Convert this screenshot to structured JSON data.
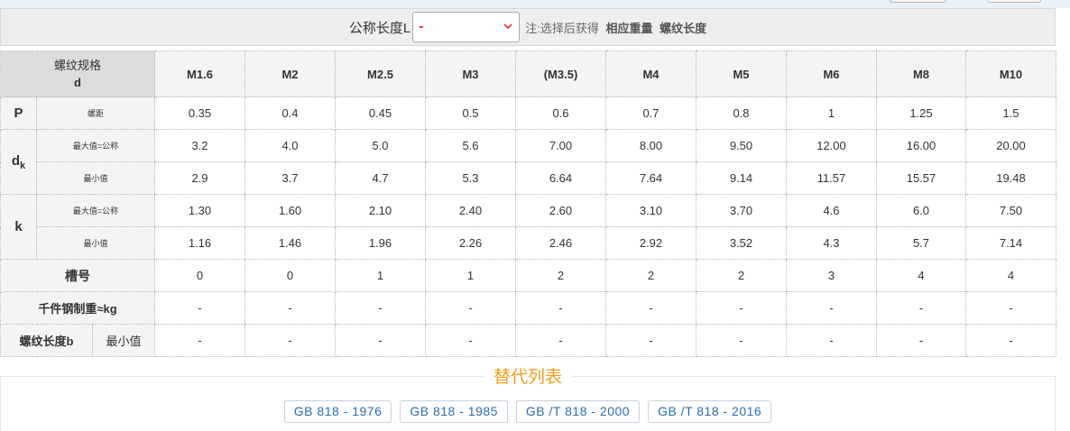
{
  "length_bar": {
    "label": "公称长度L",
    "selected": "-",
    "note_prefix": "注:选择后获得",
    "note_weight": "相应重量",
    "note_thread": "螺纹长度"
  },
  "table": {
    "header_label": "螺纹规格",
    "header_symbol": "d",
    "sizes": [
      "M1.6",
      "M2",
      "M2.5",
      "M3",
      "(M3.5)",
      "M4",
      "M5",
      "M6",
      "M8",
      "M10"
    ],
    "pitch": {
      "symbol": "P",
      "sub": "螺距",
      "values": [
        "0.35",
        "0.4",
        "0.45",
        "0.5",
        "0.6",
        "0.7",
        "0.8",
        "1",
        "1.25",
        "1.5"
      ]
    },
    "dk": {
      "symbol": "d",
      "symbol_sub": "k",
      "max_label": "最大值=公称",
      "max": [
        "3.2",
        "4.0",
        "5.0",
        "5.6",
        "7.00",
        "8.00",
        "9.50",
        "12.00",
        "16.00",
        "20.00"
      ],
      "min_label": "最小值",
      "min": [
        "2.9",
        "3.7",
        "4.7",
        "5.3",
        "6.64",
        "7.64",
        "9.14",
        "11.57",
        "15.57",
        "19.48"
      ]
    },
    "k": {
      "symbol": "k",
      "max_label": "最大值=公称",
      "max": [
        "1.30",
        "1.60",
        "2.10",
        "2.40",
        "2.60",
        "3.10",
        "3.70",
        "4.6",
        "6.0",
        "7.50"
      ],
      "min_label": "最小值",
      "min": [
        "1.16",
        "1.46",
        "1.96",
        "2.26",
        "2.46",
        "2.92",
        "3.52",
        "4.3",
        "5.7",
        "7.14"
      ]
    },
    "slot": {
      "label": "槽号",
      "values": [
        "0",
        "0",
        "1",
        "1",
        "2",
        "2",
        "2",
        "3",
        "4",
        "4"
      ]
    },
    "weight": {
      "label": "千件钢制重≈kg",
      "values": [
        "-",
        "-",
        "-",
        "-",
        "-",
        "-",
        "-",
        "-",
        "-",
        "-"
      ]
    },
    "thread_len": {
      "label": "螺纹长度b",
      "sub": "最小值",
      "values": [
        "-",
        "-",
        "-",
        "-",
        "-",
        "-",
        "-",
        "-",
        "-",
        "-"
      ]
    }
  },
  "alternatives": {
    "title": "替代列表",
    "links": [
      "GB 818 - 1976",
      "GB 818 - 1985",
      "GB /T 818 - 2000",
      "GB /T 818 - 2016"
    ]
  },
  "colors": {
    "size_header": "#1a5fa8",
    "dash": "#e4393c",
    "alt_title": "#f0a020",
    "link": "#2a6cb5"
  }
}
